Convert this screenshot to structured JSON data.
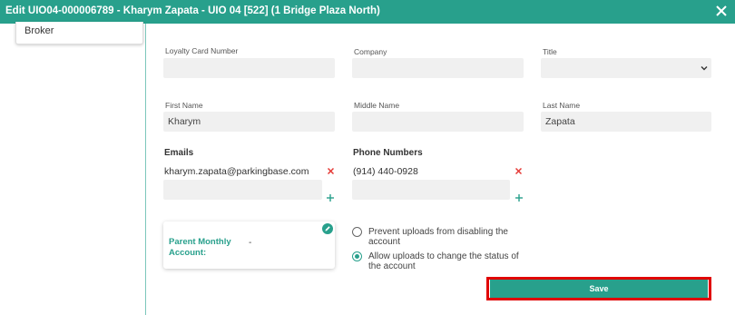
{
  "dialog": {
    "title": "Edit UIO04-000006789 - Kharym Zapata - UIO 04 [522] (1 Bridge Plaza North)",
    "close_icon": "close-icon"
  },
  "sidebar": {
    "items": [
      {
        "label": "Broker"
      }
    ]
  },
  "form": {
    "loyalty_card_number": {
      "label": "Loyalty Card Number",
      "value": ""
    },
    "company": {
      "label": "Company",
      "value": ""
    },
    "title": {
      "label": "Title",
      "value": "",
      "icon": "chevron-down-icon"
    },
    "first_name": {
      "label": "First Name",
      "value": "Kharym"
    },
    "middle_name": {
      "label": "Middle Name",
      "value": ""
    },
    "last_name": {
      "label": "Last Name",
      "value": "Zapata"
    }
  },
  "emails": {
    "heading": "Emails",
    "items": [
      "kharym.zapata@parkingbase.com"
    ],
    "new_value": ""
  },
  "phones": {
    "heading": "Phone Numbers",
    "items": [
      "(914) 440-0928"
    ],
    "new_value": ""
  },
  "parent_account": {
    "label": "Parent Monthly Account:",
    "value": "-"
  },
  "upload_options": [
    {
      "label": "Prevent uploads from disabling the account",
      "selected": false
    },
    {
      "label": "Allow uploads to change the status of the account",
      "selected": true
    }
  ],
  "actions": {
    "save_label": "Save"
  },
  "colors": {
    "accent": "#28a08c",
    "remove": "#e53935",
    "highlight_outline": "#e00000"
  }
}
